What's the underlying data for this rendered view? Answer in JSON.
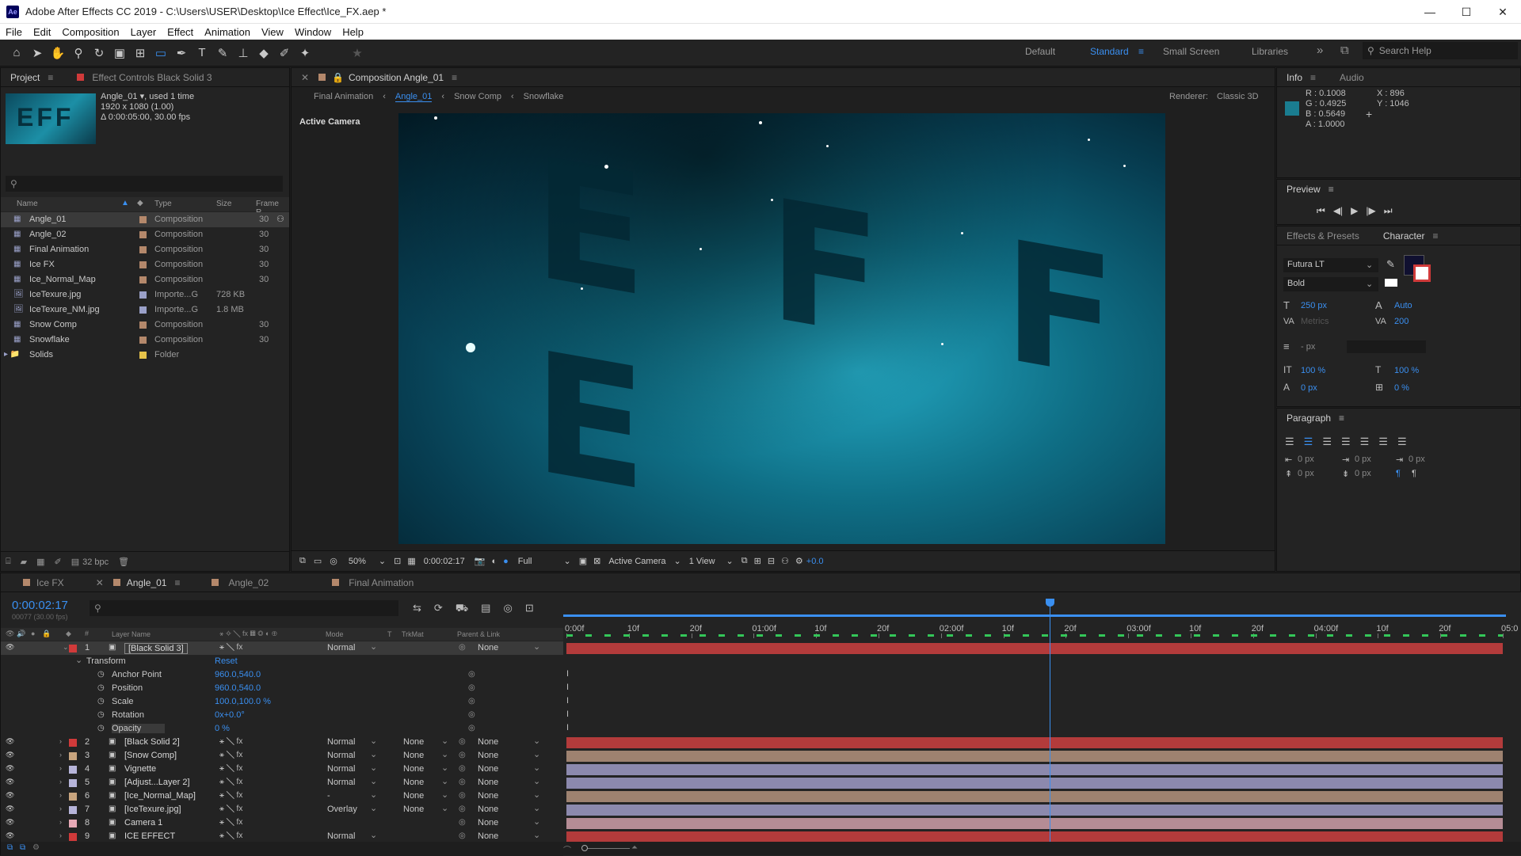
{
  "window": {
    "title": "Adobe After Effects CC 2019 - C:\\Users\\USER\\Desktop\\Ice Effect\\Ice_FX.aep *",
    "logo_text": "Ae",
    "minimize": "—",
    "maximize": "☐",
    "close": "✕"
  },
  "menu": [
    "File",
    "Edit",
    "Composition",
    "Layer",
    "Effect",
    "Animation",
    "View",
    "Window",
    "Help"
  ],
  "workspaces": {
    "default": "Default",
    "standard": "Standard",
    "small_screen": "Small Screen",
    "libraries": "Libraries",
    "more": "»",
    "search_help": "Search Help"
  },
  "project": {
    "tab": "Project",
    "effect_controls_tab": "Effect Controls Black Solid 3",
    "selected_name": "Angle_01",
    "used_text": ", used 1 time",
    "dims": "1920 x 1080 (1.00)",
    "duration": "Δ 0:00:05:00, 30.00 fps",
    "columns": {
      "name": "Name",
      "type": "Type",
      "size": "Size",
      "frame_rate": "Frame R..."
    },
    "items": [
      {
        "name": "Angle_01",
        "type": "Composition",
        "size": "",
        "fr": "30",
        "color": "#b4886b",
        "kind": "comp"
      },
      {
        "name": "Angle_02",
        "type": "Composition",
        "size": "",
        "fr": "30",
        "color": "#b4886b",
        "kind": "comp"
      },
      {
        "name": "Final Animation",
        "type": "Composition",
        "size": "",
        "fr": "30",
        "color": "#b4886b",
        "kind": "comp"
      },
      {
        "name": "Ice FX",
        "type": "Composition",
        "size": "",
        "fr": "30",
        "color": "#b4886b",
        "kind": "comp"
      },
      {
        "name": "Ice_Normal_Map",
        "type": "Composition",
        "size": "",
        "fr": "30",
        "color": "#b4886b",
        "kind": "comp"
      },
      {
        "name": "IceTexure.jpg",
        "type": "Importe...G",
        "size": "728 KB",
        "fr": "",
        "color": "#9aa0c8",
        "kind": "file"
      },
      {
        "name": "IceTexure_NM.jpg",
        "type": "Importe...G",
        "size": "1.8 MB",
        "fr": "",
        "color": "#9aa0c8",
        "kind": "file"
      },
      {
        "name": "Snow Comp",
        "type": "Composition",
        "size": "",
        "fr": "30",
        "color": "#b4886b",
        "kind": "comp"
      },
      {
        "name": "Snowflake",
        "type": "Composition",
        "size": "",
        "fr": "30",
        "color": "#b4886b",
        "kind": "comp"
      },
      {
        "name": "Solids",
        "type": "Folder",
        "size": "",
        "fr": "",
        "color": "#e6c34a",
        "kind": "folder"
      }
    ],
    "bpc": "32 bpc"
  },
  "composition": {
    "tab": "Composition Angle_01",
    "breadcrumbs": [
      "Final Animation",
      "Angle_01",
      "Snow Comp",
      "Snowflake"
    ],
    "renderer_label": "Renderer:",
    "renderer": "Classic 3D",
    "active_camera": "Active Camera",
    "viewer_text": "E F F E",
    "zoom": "50%",
    "timecode": "0:00:02:17",
    "resolution": "Full",
    "camera": "Active Camera",
    "views": "1 View",
    "exposure": "+0.0"
  },
  "info": {
    "tab": "Info",
    "audio_tab": "Audio",
    "r": "R : 0.1008",
    "g": "G : 0.4925",
    "b": "B : 0.5649",
    "a": "A : 1.0000",
    "x": "X : 896",
    "y": "Y : 1046",
    "swatch": "#1a7d90"
  },
  "preview": {
    "tab": "Preview"
  },
  "character": {
    "effects_tab": "Effects & Presets",
    "tab": "Character",
    "font": "Futura LT",
    "style": "Bold",
    "size": "250 px",
    "leading": "Auto",
    "kerning": "Metrics",
    "tracking": "200",
    "stroke": "- px",
    "vscale": "100 %",
    "hscale": "100 %",
    "baseline": "0 px",
    "tsume": "0 %"
  },
  "paragraph": {
    "tab": "Paragraph",
    "indent_left": "0 px",
    "indent_first": "0 px",
    "space_before": "0 px",
    "indent_right": "0 px",
    "space_after": "0 px"
  },
  "timeline": {
    "tabs": [
      "Ice FX",
      "Angle_01",
      "Angle_02",
      "Final Animation"
    ],
    "timecode": "0:00:02:17",
    "frames": "00077 (30.00 fps)",
    "columns": {
      "layer_name": "Layer Name",
      "mode": "Mode",
      "t": "T",
      "trkmat": "TrkMat",
      "parent": "Parent & Link"
    },
    "ruler": [
      "0:00f",
      "10f",
      "20f",
      "01:00f",
      "10f",
      "20f",
      "02:00f",
      "10f",
      "20f",
      "03:00f",
      "10f",
      "20f",
      "04:00f",
      "10f",
      "20f",
      "05:0"
    ],
    "transform": {
      "label": "Transform",
      "reset": "Reset",
      "props": [
        {
          "name": "Anchor Point",
          "value": "960.0,540.0"
        },
        {
          "name": "Position",
          "value": "960.0,540.0"
        },
        {
          "name": "Scale",
          "value": "100.0,100.0 %"
        },
        {
          "name": "Rotation",
          "value": "0x+0.0°"
        },
        {
          "name": "Opacity",
          "value": "0 %"
        }
      ]
    },
    "layers": [
      {
        "num": "1",
        "name": "[Black Solid 3]",
        "label_color": "#d03a3a",
        "mode": "Normal",
        "trkmat": "",
        "parent": "None",
        "bar": "#b33b3b"
      },
      {
        "num": "2",
        "name": "[Black Solid 2]",
        "label_color": "#d03a3a",
        "mode": "Normal",
        "trkmat": "None",
        "parent": "None",
        "bar": "#b33b3b"
      },
      {
        "num": "3",
        "name": "[Snow Comp]",
        "label_color": "#c8a47e",
        "mode": "Normal",
        "trkmat": "None",
        "parent": "None",
        "bar": "#9e8270"
      },
      {
        "num": "4",
        "name": "Vignette",
        "label_color": "#b6b4d9",
        "mode": "Normal",
        "trkmat": "None",
        "parent": "None",
        "bar": "#8c89ad"
      },
      {
        "num": "5",
        "name": "[Adjust...Layer 2]",
        "label_color": "#b6b4d9",
        "mode": "Normal",
        "trkmat": "None",
        "parent": "None",
        "bar": "#8c89ad"
      },
      {
        "num": "6",
        "name": "[Ice_Normal_Map]",
        "label_color": "#c8a47e",
        "mode": "-",
        "trkmat": "None",
        "parent": "None",
        "bar": "#9e8270"
      },
      {
        "num": "7",
        "name": "[IceTexure.jpg]",
        "label_color": "#b6b4d9",
        "mode": "Overlay",
        "trkmat": "None",
        "parent": "None",
        "bar": "#8c89ad"
      },
      {
        "num": "8",
        "name": "Camera 1",
        "label_color": "#e7a9b6",
        "mode": "",
        "trkmat": "",
        "parent": "None",
        "bar": "#b58c95"
      },
      {
        "num": "9",
        "name": "ICE EFFECT",
        "label_color": "#d03a3a",
        "mode": "Normal",
        "trkmat": "",
        "parent": "None",
        "bar": "#b33b3b"
      }
    ],
    "playhead_fraction": 0.516
  }
}
